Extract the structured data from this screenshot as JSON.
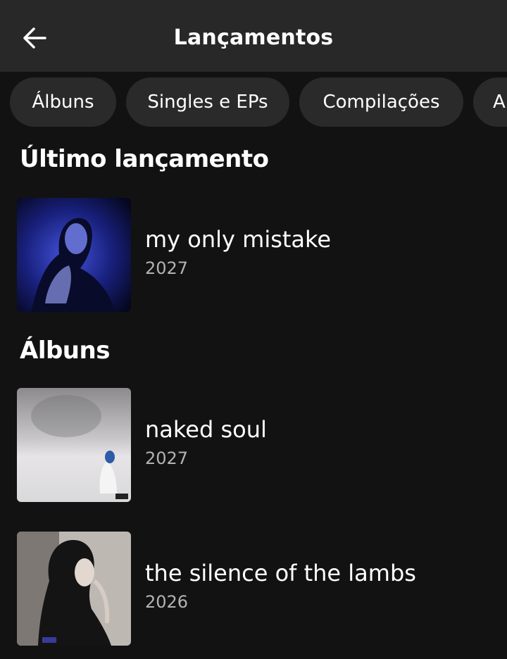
{
  "header": {
    "title": "Lançamentos",
    "back_icon": "arrow-left-icon"
  },
  "filters": [
    {
      "label": "Álbuns"
    },
    {
      "label": "Singles e EPs"
    },
    {
      "label": "Compilações"
    },
    {
      "label": "A"
    }
  ],
  "sections": {
    "latest": {
      "title": "Último lançamento",
      "items": [
        {
          "title": "my only mistake",
          "year": "2027"
        }
      ]
    },
    "albums": {
      "title": "Álbuns",
      "items": [
        {
          "title": "naked soul",
          "year": "2027"
        },
        {
          "title": "the silence of the lambs",
          "year": "2026"
        }
      ]
    }
  },
  "colors": {
    "background": "#121212",
    "header": "#282828",
    "chip": "#2a2a2a",
    "secondary_text": "#b3b3b3"
  }
}
